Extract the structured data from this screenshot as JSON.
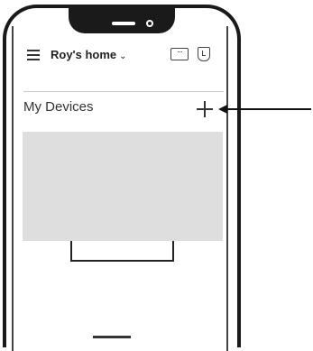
{
  "header": {
    "home_title": "Roy's home",
    "chevron": "⌄",
    "menu_icon": "hamburger-menu-icon",
    "chat_icon": "chat-bubble-icon",
    "chat_glyph": "···",
    "shield_icon": "shield-icon"
  },
  "section": {
    "title": "My Devices",
    "add_icon": "plus-icon"
  },
  "annotation": {
    "arrow": "arrow-pointing-left-icon"
  },
  "colors": {
    "card_background": "#dedede",
    "frame": "#1a1a1a",
    "divider": "#c8c8c8"
  }
}
